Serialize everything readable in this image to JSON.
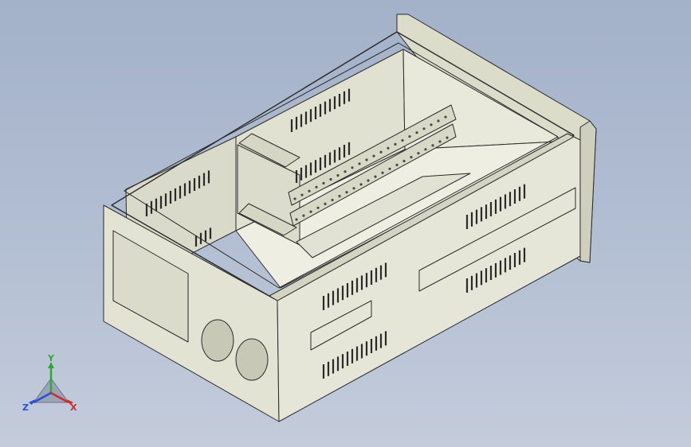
{
  "scene": {
    "background_top": "#a3b1c9",
    "background_bottom": "#c4ccdb",
    "part_fill": "#e6e6d8",
    "part_shade": "#d4d4c3",
    "part_dark": "#b9b9a8",
    "edge_color": "#2a2a2a"
  },
  "triad": {
    "x_label": "X",
    "y_label": "Y",
    "z_label": "Z",
    "x_color": "#d42a2a",
    "y_color": "#2fa83a",
    "z_color": "#2a4fd4"
  }
}
